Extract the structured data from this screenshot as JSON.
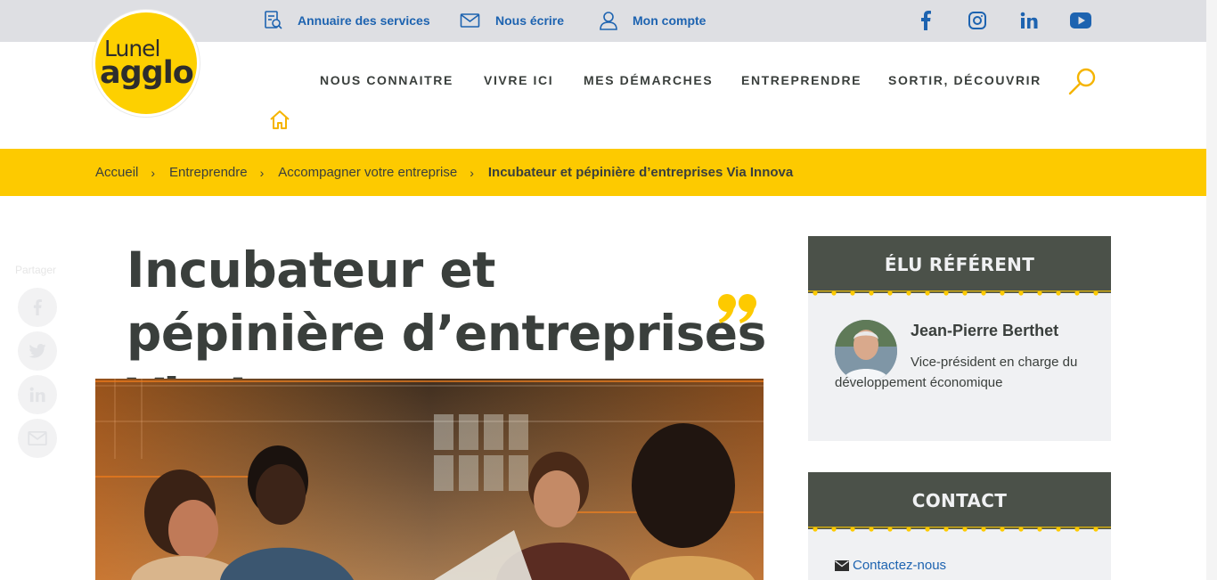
{
  "utility_bar": {
    "links": [
      {
        "label": "Annuaire des services",
        "icon": "directory-icon"
      },
      {
        "label": "Nous écrire",
        "icon": "envelope-icon"
      },
      {
        "label": "Mon compte",
        "icon": "user-icon"
      }
    ],
    "social": [
      "facebook-icon",
      "instagram-icon",
      "linkedin-icon",
      "youtube-icon"
    ]
  },
  "logo": {
    "line1": "Lunel",
    "line2": "agglo"
  },
  "nav": {
    "items": [
      {
        "label": "NOUS CONNAITRE"
      },
      {
        "label": "VIVRE ICI"
      },
      {
        "label": "MES DÉMARCHES"
      },
      {
        "label": "ENTREPRENDRE"
      },
      {
        "label": "SORTIR, DÉCOUVRIR"
      }
    ]
  },
  "breadcrumb": {
    "items": [
      "Accueil",
      "Entreprendre",
      "Accompagner votre entreprise"
    ],
    "separator": "›",
    "current": "Incubateur et pépinière d’entreprises Via Innova"
  },
  "share": {
    "label": "Partager",
    "buttons": [
      "facebook-icon",
      "twitter-icon",
      "linkedin-icon",
      "email-icon"
    ]
  },
  "page": {
    "title": "Incubateur et pépinière d’entreprises Via Innova"
  },
  "sidebar": {
    "elu": {
      "heading": "ÉLU RÉFÉRENT",
      "name": "Jean-Pierre Berthet",
      "role": "Vice-président en charge du développement économique"
    },
    "contact": {
      "heading": "CONTACT",
      "link": "Contactez-nous"
    }
  },
  "colors": {
    "accent_yellow": "#fdca00",
    "link_blue": "#1d63b0",
    "dark_text": "#3a3f3c",
    "card_header": "#4b5149",
    "card_bg": "#f0f1f3"
  }
}
